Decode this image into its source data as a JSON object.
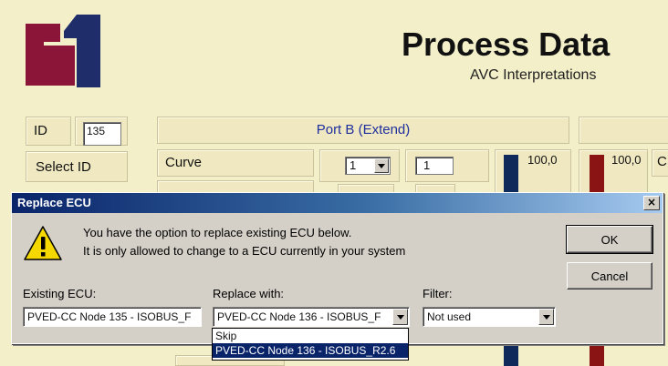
{
  "header": {
    "title": "Process Data",
    "subtitle": "AVC Interpretations",
    "logo_colors": {
      "maroon": "#8a1538",
      "navy": "#1f2d6b"
    }
  },
  "background": {
    "id_label": "ID",
    "id_value": "135",
    "select_id_label": "Select ID",
    "port_b_label": "Port B (Extend)",
    "curve_label": "Curve",
    "curve_select_value": "1",
    "curve_input_value": "1",
    "bar1_value": "100,0",
    "bar2_value": "100,0",
    "partial_label": "C"
  },
  "dialog": {
    "title": "Replace ECU",
    "close_glyph": "×",
    "message_line1": "You have the option to replace existing ECU below.",
    "message_line2": "It is only allowed to change to a ECU currently in your system",
    "ok_label": "OK",
    "cancel_label": "Cancel",
    "existing_label": "Existing ECU:",
    "existing_value": "PVED-CC Node 135 - ISOBUS_F",
    "replace_label": "Replace with:",
    "replace_value": "PVED-CC Node 136 - ISOBUS_F",
    "filter_label": "Filter:",
    "filter_value": "Not used",
    "dropdown_options": [
      "Skip",
      "PVED-CC Node 136 - ISOBUS_R2.6"
    ],
    "dropdown_selected_index": 1
  }
}
